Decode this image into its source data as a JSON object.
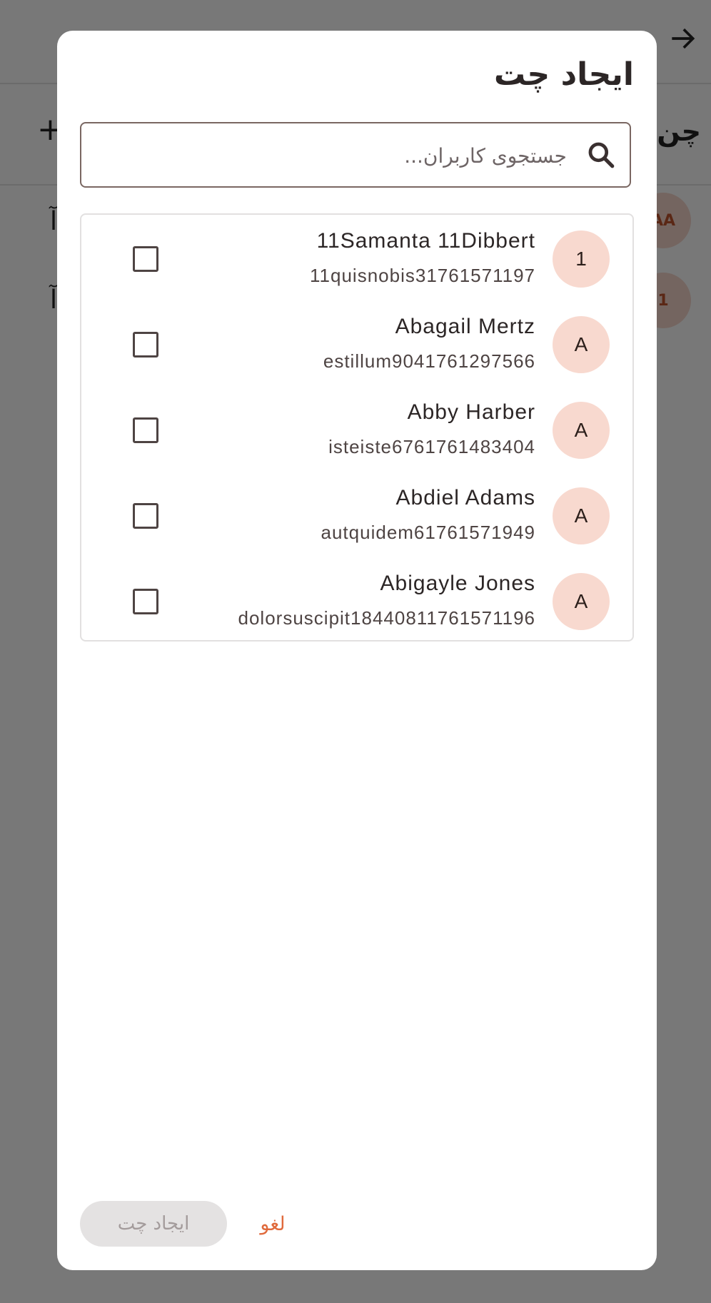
{
  "background": {
    "title_fragment": "چن",
    "plus_icon": "plus-icon",
    "rows": [
      {
        "avatar": "AA",
        "text": "آ"
      },
      {
        "avatar": "1",
        "text": "آ"
      }
    ]
  },
  "dialog": {
    "title": "ایجاد چت",
    "search": {
      "placeholder": "جستجوی کاربران...",
      "value": "",
      "icon": "search-icon"
    },
    "users": [
      {
        "initial": "1",
        "name": "11Samanta 11Dibbert",
        "username": "11quisnobis31761571197",
        "checked": false
      },
      {
        "initial": "A",
        "name": "Abagail Mertz",
        "username": "estillum9041761297566",
        "checked": false
      },
      {
        "initial": "A",
        "name": "Abby Harber",
        "username": "isteiste6761761483404",
        "checked": false
      },
      {
        "initial": "A",
        "name": "Abdiel Adams",
        "username": "autquidem61761571949",
        "checked": false
      },
      {
        "initial": "A",
        "name": "Abigayle Jones",
        "username": "dolorsuscipit18440811761571196",
        "checked": false
      }
    ],
    "actions": {
      "create_label": "ایجاد چت",
      "cancel_label": "لغو"
    }
  },
  "colors": {
    "accent": "#e06a3c",
    "avatar_bg": "#f8d9cf",
    "disabled_button_bg": "#e4e2e2"
  }
}
